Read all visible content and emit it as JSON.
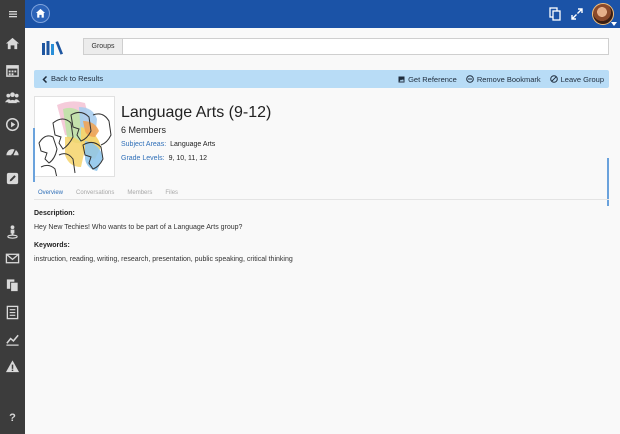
{
  "topbar": {
    "menu_icon": "hamburger-icon",
    "home_icon": "home-icon",
    "right_icons": [
      "copy-icon",
      "expand-icon"
    ],
    "avatar": "user-avatar"
  },
  "sidebar": {
    "items": [
      {
        "icon": "home-icon"
      },
      {
        "icon": "calendar-icon"
      },
      {
        "icon": "users-icon"
      },
      {
        "icon": "play-icon"
      },
      {
        "icon": "dashboard-icon"
      },
      {
        "icon": "edit-icon"
      },
      {
        "icon": "person-pin-icon"
      },
      {
        "icon": "mail-icon"
      },
      {
        "icon": "documents-icon"
      },
      {
        "icon": "list-icon"
      },
      {
        "icon": "chart-icon"
      },
      {
        "icon": "warning-icon"
      },
      {
        "icon": "help-icon"
      }
    ],
    "help_label": "?"
  },
  "search": {
    "tab_label": "Groups",
    "value": ""
  },
  "actionbar": {
    "back_label": "Back to Results",
    "get_reference_label": "Get Reference",
    "remove_bookmark_label": "Remove Bookmark",
    "leave_group_label": "Leave Group"
  },
  "group": {
    "title": "Language Arts (9-12)",
    "members": "6 Members",
    "subject_areas_label": "Subject Areas:",
    "subject_areas_value": "Language Arts",
    "grade_levels_label": "Grade Levels:",
    "grade_levels_value": "9, 10, 11, 12"
  },
  "tabs": [
    {
      "label": "Overview",
      "active": true
    },
    {
      "label": "Conversations",
      "active": false
    },
    {
      "label": "Members",
      "active": false
    },
    {
      "label": "Files",
      "active": false
    }
  ],
  "overview": {
    "description_label": "Description:",
    "description_text": "Hey New Techies! Who wants to be part of a Language Arts group?",
    "keywords_label": "Keywords:",
    "keywords_text": "instruction, reading, writing, research, presentation, public speaking, critical thinking"
  },
  "colors": {
    "topbar": "#1b53a7",
    "sidebar": "#3c3c3c",
    "actionbar": "#b8dcf6",
    "link": "#2f6fb8"
  }
}
